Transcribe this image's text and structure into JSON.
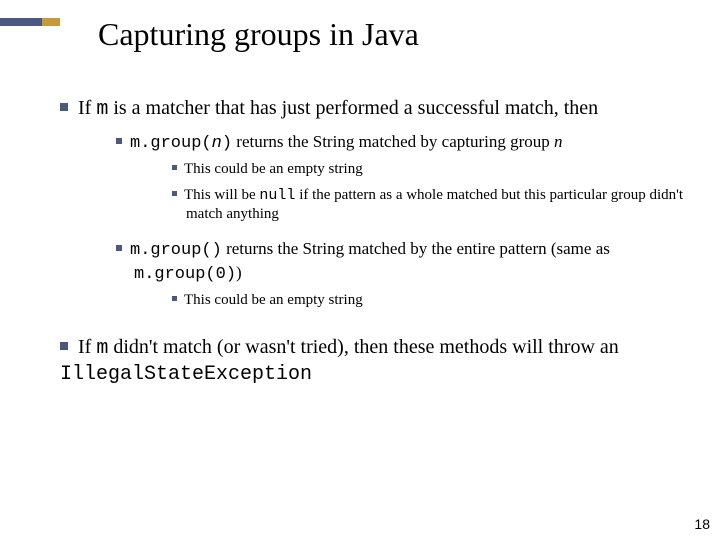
{
  "title": "Capturing groups in Java",
  "bullets": {
    "a": {
      "pre": "If ",
      "code1": "m",
      "post": " is a matcher that has just performed a successful match, then",
      "sub": {
        "s1": {
          "code1": "m.group(",
          "ital1": "n",
          "code2": ")",
          "rest": "  returns the String matched by capturing group ",
          "ital2": "n",
          "notes": {
            "n1": "This could be an empty string",
            "n2a": "This will be ",
            "n2code": "null",
            "n2b": " if the pattern as a whole matched but this particular group didn't match anything"
          }
        },
        "s2": {
          "code1": "m.group()",
          "rest1": "  returns the String matched by the entire pattern (same as ",
          "code2": "m.group(0)",
          "rest2": ")",
          "notes": {
            "n1": "This could be an empty string"
          }
        }
      }
    },
    "b": {
      "pre": "If ",
      "code1": "m",
      "mid": " didn't match (or wasn't tried), then these methods will throw an ",
      "code2": "IllegalStateException"
    }
  },
  "pagenum": "18"
}
